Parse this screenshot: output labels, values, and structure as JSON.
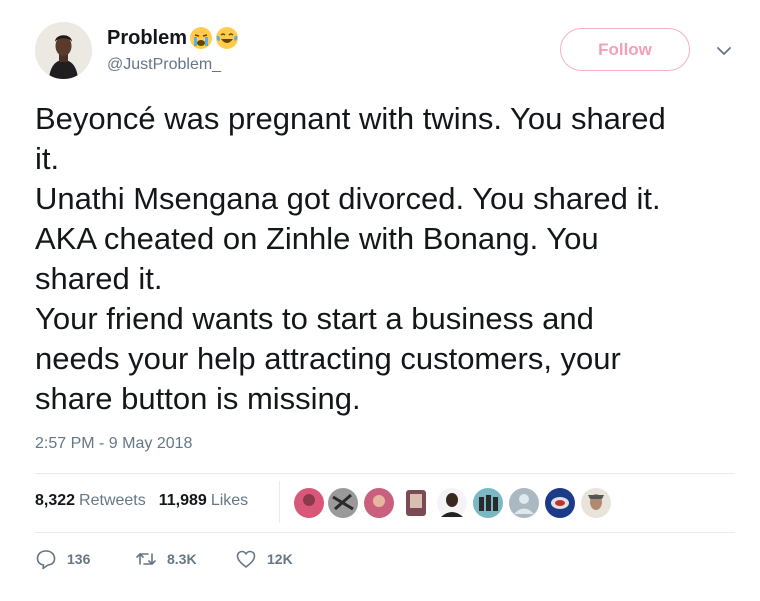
{
  "author": {
    "name": "Problem",
    "handle": "@JustProblem_",
    "avatar_icon": "profile-photo",
    "name_emojis": [
      "crying-face-emoji",
      "tears-of-joy-emoji"
    ]
  },
  "follow_button": {
    "label": "Follow",
    "color": "#f2a0b8"
  },
  "more_menu_icon": "chevron-down-icon",
  "tweet": {
    "lines": [
      "Beyoncé was pregnant with twins. You shared",
      "it.",
      "Unathi Msengana got divorced. You shared it.",
      "AKA cheated on Zinhle with Bonang. You",
      "shared it.",
      "Your friend wants to start a business and",
      "needs your help attracting customers, your",
      "share button is missing."
    ],
    "timestamp": "2:57 PM - 9 May 2018"
  },
  "stats": {
    "retweets_count": "8,322",
    "retweets_label": "Retweets",
    "likes_count": "11,989",
    "likes_label": "Likes",
    "liker_avatars": [
      "liker-avatar",
      "liker-avatar",
      "liker-avatar",
      "liker-avatar",
      "liker-avatar",
      "liker-avatar",
      "default-avatar",
      "liker-avatar",
      "liker-avatar"
    ]
  },
  "actions": {
    "replies": "136",
    "retweets": "8.3K",
    "likes": "12K"
  },
  "colors": {
    "text": "#14171a",
    "muted": "#657786",
    "divider": "#e6ecf0"
  }
}
